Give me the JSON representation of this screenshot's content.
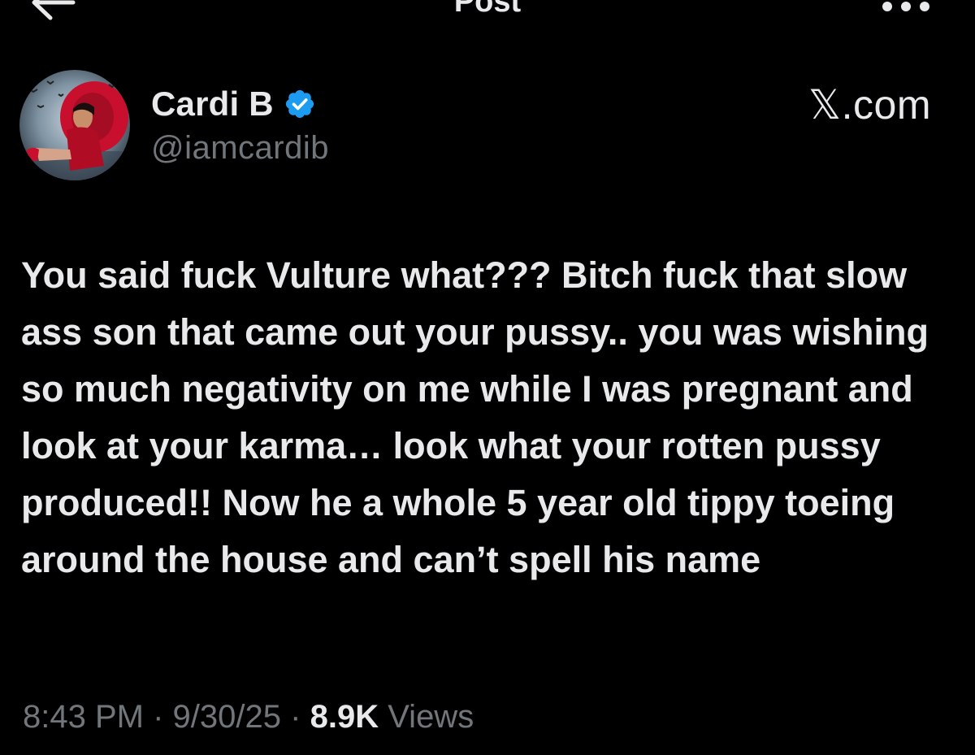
{
  "header": {
    "title": "Post",
    "back_icon": "arrow-left-icon",
    "more_icon": "more-horizontal-icon"
  },
  "author": {
    "display_name": "Cardi B",
    "handle": "@iamcardib",
    "verified_icon": "verified-badge-icon",
    "verified_color": "#1d9bf0",
    "avatar_icon": "profile-photo"
  },
  "source": {
    "label": "𝕏.com"
  },
  "post": {
    "text": "You said fuck Vulture what??? Bitch fuck that slow ass son that came out your pussy.. you was wishing so much negativity on me while I was pregnant and look at your karma… look what your rotten pussy produced!! Now he a whole 5 year old tippy toeing around the house and can’t spell his name"
  },
  "meta": {
    "time": "8:43 PM",
    "separator": "·",
    "date": "9/30/25",
    "views_count": "8.9K",
    "views_label": "Views"
  },
  "colors": {
    "background": "#000000",
    "text_primary": "#e7e9ea",
    "text_secondary": "#71767b"
  }
}
